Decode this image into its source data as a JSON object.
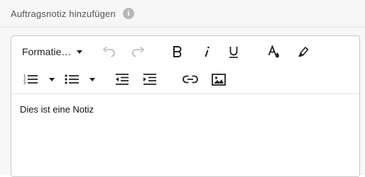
{
  "header": {
    "title": "Auftragsnotiz hinzufügen",
    "info_icon": "info-icon"
  },
  "toolbar": {
    "format_label": "Formatie…",
    "row1_icons": [
      "undo-icon",
      "redo-icon",
      "bold-icon",
      "italic-icon",
      "underline-icon",
      "text-color-icon",
      "highlight-icon"
    ],
    "row2_icons": [
      "ordered-list-icon",
      "unordered-list-icon",
      "outdent-icon",
      "indent-icon",
      "link-icon",
      "image-icon"
    ]
  },
  "editor": {
    "content": "Dies ist eine Notiz"
  },
  "colors": {
    "background": "#f7f7f7",
    "icon": "#222222",
    "disabled_icon": "#b5b5b5",
    "border": "#c9c9c9"
  }
}
